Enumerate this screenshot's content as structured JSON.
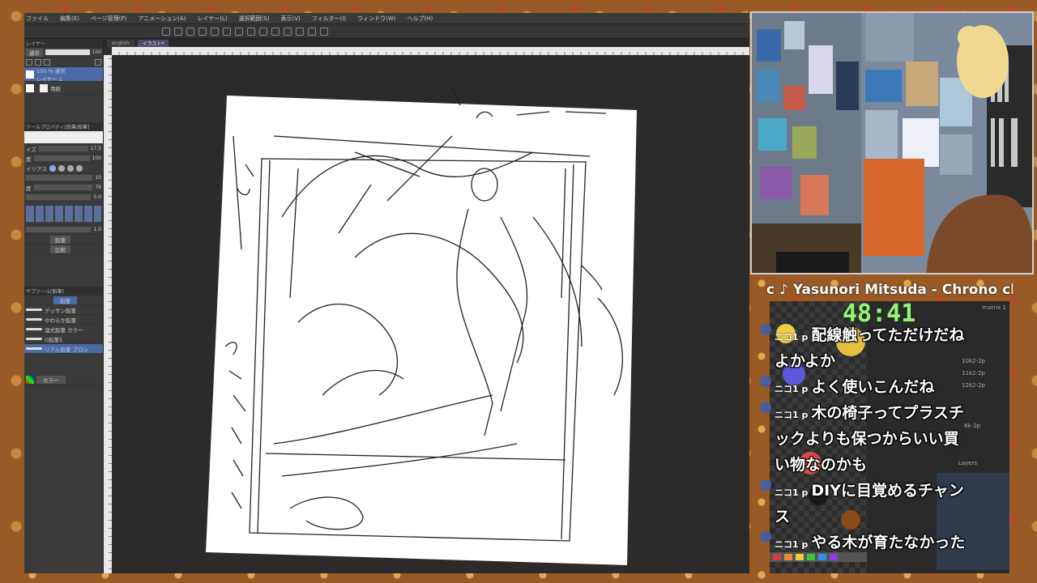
{
  "menu": [
    "ファイル",
    "編集(E)",
    "ページ管理(P)",
    "アニメーション(A)",
    "レイヤー(L)",
    "選択範囲(S)",
    "表示(V)",
    "フィルター(I)",
    "ウィンドウ(W)",
    "ヘルプ(H)"
  ],
  "doc_tabs": [
    "english",
    "イラスト*"
  ],
  "layer_panel": {
    "mode": "通常",
    "opacity": "100",
    "layer_name": "100 % 通常",
    "layer_sub": "レイヤー 1",
    "paper": "用紙"
  },
  "tool_props": {
    "header": "ツールプロパティ[鉛筆/鉛筆]",
    "size_label": "イズ",
    "size_val": "17.5",
    "density_label": "度",
    "density_val": "100",
    "aa_label": "イリアス",
    "hardness_label": "度",
    "hardness_val": "79",
    "brush_size_val": "5.0",
    "flow_val": "1.0",
    "pencil_label": "鉛筆",
    "blend_label": "比較"
  },
  "sub_tools": {
    "header": "サブツール[鉛筆]",
    "tab_label": "鉛筆",
    "items": [
      "デッサン鉛筆",
      "やわらか鉛筆",
      "湿式鉛筆 カラー",
      "G鉛筆5",
      "リアル鉛筆 ブロン"
    ]
  },
  "color_label": "カラー",
  "now_playing": "c ♪ Yasunori Mitsuda - Chrono chro",
  "timer": "48:41",
  "chat": [
    {
      "prefix": "ニコ1 p",
      "text": "配線触ってただけだね"
    },
    {
      "prefix": "",
      "text": "よかよか"
    },
    {
      "prefix": "ニコ1 p",
      "text": "よく使いこんだね"
    },
    {
      "prefix": "ニコ1 p",
      "text": "木の椅子ってプラスチ"
    },
    {
      "prefix": "",
      "text": "ックよりも保つからいい買"
    },
    {
      "prefix": "",
      "text": "い物なのかも"
    },
    {
      "prefix": "ニコ1 p",
      "text": "DIYに目覚めるチャン"
    },
    {
      "prefix": "",
      "text": "ス"
    },
    {
      "prefix": "ニコ1 p",
      "text": "やる木が育たなかった"
    }
  ],
  "right_panel": {
    "layers_label": "Layers",
    "items": [
      "matrix 1",
      "10k2-2p",
      "11k2-2p",
      "12k2-2p",
      "6k-2p"
    ]
  },
  "colors": {
    "timer": "#9af07a",
    "accent": "#4a6aa8"
  }
}
